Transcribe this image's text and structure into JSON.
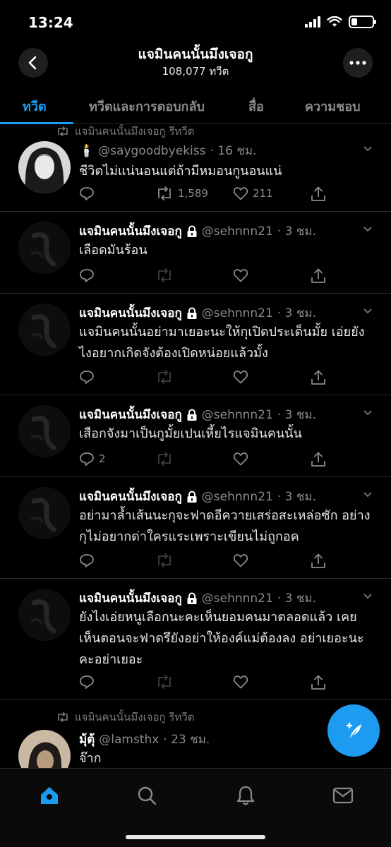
{
  "status": {
    "time": "13:24"
  },
  "header": {
    "title": "แจมินคนนั้นมึงเจอกู",
    "subtitle": "108,077 ทวีต"
  },
  "tabs": [
    {
      "label": "ทวีต",
      "active": true
    },
    {
      "label": "ทวีตและการตอบกลับ",
      "active": false
    },
    {
      "label": "สื่อ",
      "active": false
    },
    {
      "label": "ความชอบ",
      "active": false
    }
  ],
  "tweets": [
    {
      "retweet_label": "แจมินคนนั้นมึงเจอกู รีทวีต",
      "name": "🕯️",
      "handle": "@saygoodbyekiss",
      "time": "· 16 ชม.",
      "text": "ชีวิตไม่แน่นอนแต่ถ้ามีหมอนกูนอนแน่",
      "replies": "",
      "retweets": "1,589",
      "likes": "211"
    },
    {
      "name": "แจมินคนนั้นมึงเจอกู",
      "handle": "@sehnnn21",
      "time": "· 3 ชม.",
      "text": "เลือดมันร้อน",
      "replies": "",
      "retweets": "",
      "likes": ""
    },
    {
      "name": "แจมินคนนั้นมึงเจอกู",
      "handle": "@sehnnn21",
      "time": "· 3 ชม.",
      "text": "แจมินคนนั้นอย่ามาเยอะนะให้กุเปิดประเด็นมั้ย เอ่ยยังไงอยากเกิดจังต้องเปิดหน่อยแล้วมั้ง",
      "replies": "",
      "retweets": "",
      "likes": ""
    },
    {
      "name": "แจมินคนนั้นมึงเจอกู",
      "handle": "@sehnnn21",
      "time": "· 3 ชม.",
      "text": "เสือกจังมาเป็นกูมั้ยเปนเหี้ยไรแจมินคนนั้น",
      "replies": "2",
      "retweets": "",
      "likes": ""
    },
    {
      "name": "แจมินคนนั้นมึงเจอกู",
      "handle": "@sehnnn21",
      "time": "· 3 ชม.",
      "text": "อย่ามาล้ำเส้นนะกุจะฟาดอีควายเสร่อสะเหล่อซัก อย่างกุไม่อยากด่าใครแระเพราะเขียนไม่ถูกอค",
      "replies": "",
      "retweets": "",
      "likes": ""
    },
    {
      "name": "แจมินคนนั้นมึงเจอกู",
      "handle": "@sehnnn21",
      "time": "· 3 ชม.",
      "text": "ยังไงเอ่ยหนูเลือกนะคะเห็นยอมคนมาตลอดแล้ว เคยเห็นตอนจะฟาดรึยังอย่าให้องค์แม่ต้องลง อย่าเยอะนะคะอย่าเยอะ",
      "replies": "",
      "retweets": "",
      "likes": ""
    },
    {
      "retweet_label": "แจมินคนนั้นมึงเจอกู รีทวีต",
      "name": "มุ้ตุ้",
      "handle": "@lamsthx",
      "time": "· 23 ชม.",
      "text": "จ๊าก",
      "replies": "",
      "retweets": "",
      "likes": ""
    }
  ],
  "colors": {
    "accent": "#1d9bf0",
    "background": "#000000",
    "muted": "#8a8a8a"
  },
  "icons": {
    "back": "back-arrow-icon",
    "more": "more-icon",
    "reply": "reply-icon",
    "retweet": "retweet-icon",
    "like": "heart-icon",
    "share": "share-icon",
    "compose": "compose-icon",
    "home": "home-icon",
    "search": "search-icon",
    "notifications": "bell-icon",
    "messages": "mail-icon"
  }
}
